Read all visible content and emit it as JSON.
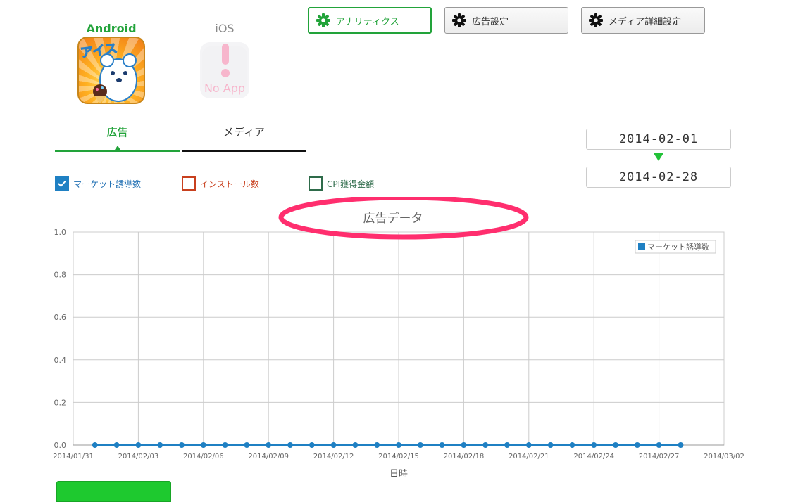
{
  "platforms": {
    "android": {
      "label": "Android",
      "icon_text": "アイス"
    },
    "ios": {
      "label": "iOS",
      "no_app_text": "No App"
    }
  },
  "top_tabs": [
    {
      "label": "アナリティクス",
      "icon": "gear-icon",
      "active": true
    },
    {
      "label": "広告設定",
      "icon": "gear-icon",
      "active": false
    },
    {
      "label": "メディア詳細設定",
      "icon": "gear-icon",
      "active": false
    }
  ],
  "sub_tabs": [
    {
      "label": "広告",
      "active": true
    },
    {
      "label": "メディア",
      "active": false
    }
  ],
  "date_range": {
    "start": "2014-02-01",
    "end": "2014-02-28"
  },
  "metrics": [
    {
      "label": "マーケット誘導数",
      "checked": true,
      "color": "#1f80c3"
    },
    {
      "label": "インストール数",
      "checked": false,
      "color": "#c8401e"
    },
    {
      "label": "CPI獲得金額",
      "checked": false,
      "color": "#2e6b4a"
    }
  ],
  "colors": {
    "accent": "#22a33a",
    "highlight": "#ff2e6e",
    "series": "#1f80c3"
  },
  "chart_data": {
    "type": "line",
    "title": "広告データ",
    "xlabel": "日時",
    "ylabel": "",
    "ylim": [
      0,
      1.0
    ],
    "y_ticks": [
      "0.0",
      "0.2",
      "0.4",
      "0.6",
      "0.8",
      "1.0"
    ],
    "x_tick_labels": [
      "2014/01/31",
      "2014/02/03",
      "2014/02/06",
      "2014/02/09",
      "2014/02/12",
      "2014/02/15",
      "2014/02/18",
      "2014/02/21",
      "2014/02/24",
      "2014/02/27",
      "2014/03/02"
    ],
    "x": [
      "2014/02/01",
      "2014/02/02",
      "2014/02/03",
      "2014/02/04",
      "2014/02/05",
      "2014/02/06",
      "2014/02/07",
      "2014/02/08",
      "2014/02/09",
      "2014/02/10",
      "2014/02/11",
      "2014/02/12",
      "2014/02/13",
      "2014/02/14",
      "2014/02/15",
      "2014/02/16",
      "2014/02/17",
      "2014/02/18",
      "2014/02/19",
      "2014/02/20",
      "2014/02/21",
      "2014/02/22",
      "2014/02/23",
      "2014/02/24",
      "2014/02/25",
      "2014/02/26",
      "2014/02/27",
      "2014/02/28"
    ],
    "series": [
      {
        "name": "マーケット誘導数",
        "values": [
          0,
          0,
          0,
          0,
          0,
          0,
          0,
          0,
          0,
          0,
          0,
          0,
          0,
          0,
          0,
          0,
          0,
          0,
          0,
          0,
          0,
          0,
          0,
          0,
          0,
          0,
          0,
          0
        ]
      }
    ],
    "legend": "top-right",
    "grid": true
  }
}
